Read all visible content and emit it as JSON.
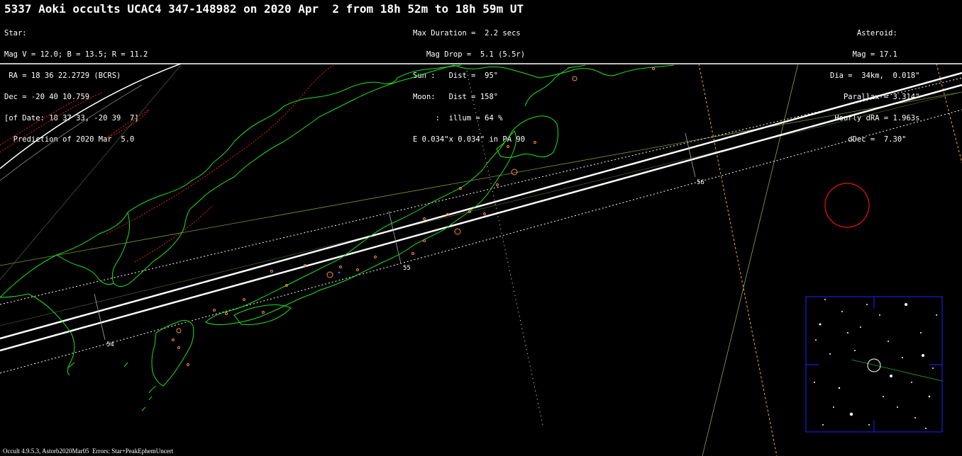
{
  "title": "5337 Aoki occults UCAC4 347-148982 on 2020 Apr  2 from 18h 52m to 18h 59m UT",
  "star_block": [
    "Star:",
    "Mag V = 12.0; B = 13.5; R = 11.2",
    " RA = 18 36 22.2729 (BCRS)",
    "Dec = -20 40 10.759",
    "[of Date: 18 37 33, -20 39  7]",
    "  Prediction of 2020 Mar  5.0"
  ],
  "mid_block": [
    "Max Duration =  2.2 secs",
    "   Mag Drop =  5.1 (5.5r)",
    "Sun :   Dist =  95°",
    "Moon:   Dist = 158°",
    "     :  illum = 64 %",
    "E 0.034\"x 0.034\" in PA 90"
  ],
  "asteroid_block": [
    "Asteroid:     ",
    "Mag = 17.1     ",
    "Dia =  34km,  0.018\"",
    "Parallax = 3.314\"",
    "Hourly dRA = 1.963s",
    "dDec =  7.30\"   "
  ],
  "time_labels": {
    "t54": "54",
    "t55": "55",
    "t56": "56"
  },
  "footer": "Occult 4.9.5.3, Astorb2020Mar05  Errors: Star+PeakEphemUncert",
  "colors": {
    "coast": "#22dd22",
    "path": "#ffffff",
    "sigma": "#ffffff",
    "twilight": "#dd2222",
    "terminator": "#ffaa22",
    "star_field_frame": "#2222ff",
    "moon_circle": "#ee1111",
    "city": "#ff8844"
  }
}
